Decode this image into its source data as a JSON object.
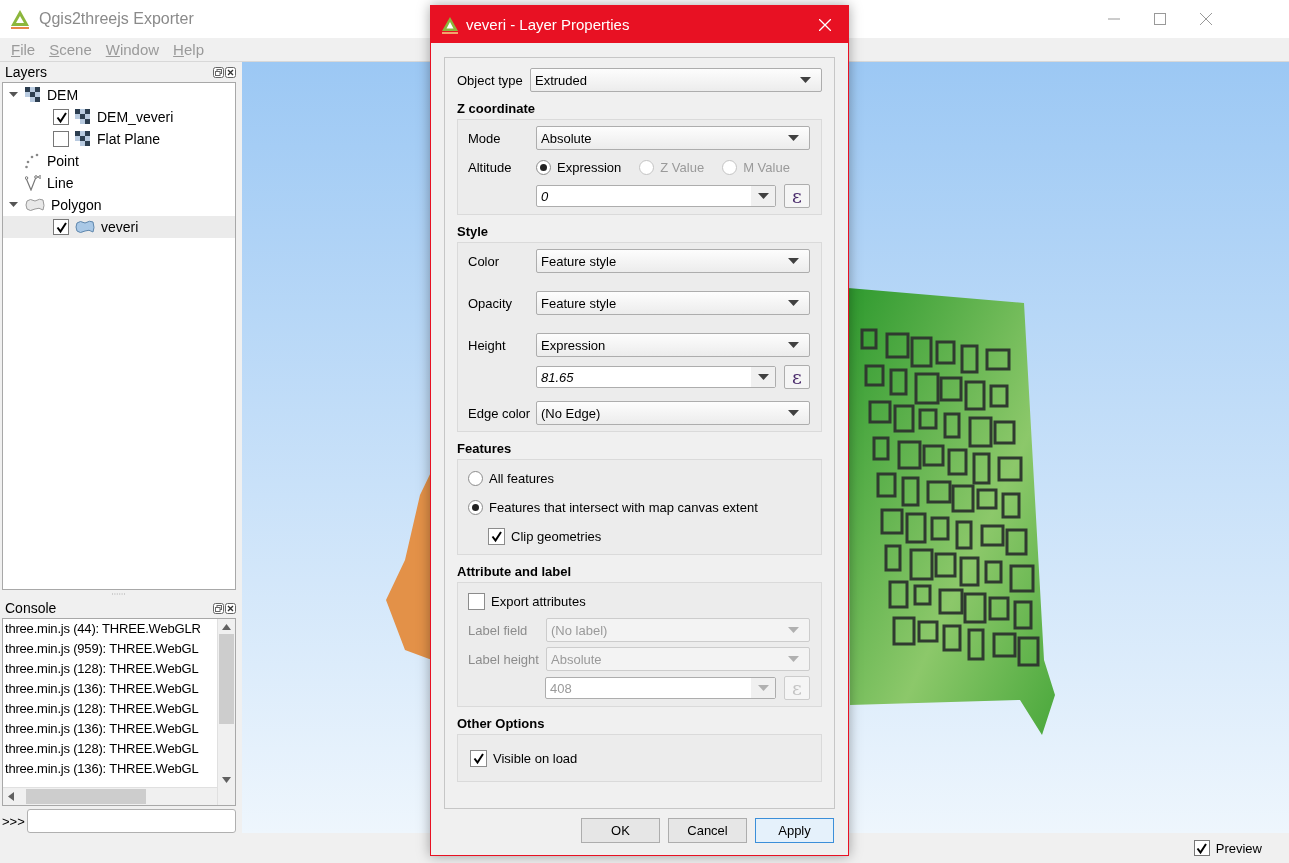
{
  "window": {
    "title": "Qgis2threejs Exporter"
  },
  "menu": [
    "File",
    "Scene",
    "Window",
    "Help"
  ],
  "layers_panel": {
    "title": "Layers",
    "tree": [
      {
        "label": "DEM",
        "kind": "raster",
        "expanded": true,
        "selected": false,
        "children": [
          {
            "label": "DEM_veveri",
            "kind": "raster",
            "checked": true,
            "selected": false
          },
          {
            "label": "Flat Plane",
            "kind": "raster",
            "checked": false,
            "selected": false
          }
        ]
      },
      {
        "label": "Point",
        "kind": "point",
        "selected": false
      },
      {
        "label": "Line",
        "kind": "line",
        "selected": false
      },
      {
        "label": "Polygon",
        "kind": "polygon",
        "expanded": true,
        "selected": false,
        "children": [
          {
            "label": "veveri",
            "kind": "polygon",
            "checked": true,
            "selected": true
          }
        ]
      }
    ]
  },
  "console": {
    "title": "Console",
    "lines": [
      "three.min.js (44): THREE.WebGLR",
      "three.min.js (959): THREE.WebGL",
      "three.min.js (128): THREE.WebGL",
      "three.min.js (136): THREE.WebGL",
      "three.min.js (128): THREE.WebGL",
      "three.min.js (136): THREE.WebGL",
      "three.min.js (128): THREE.WebGL",
      "three.min.js (136): THREE.WebGL"
    ],
    "prompt": ">>>"
  },
  "status_bar": {
    "preview": {
      "label": "Preview",
      "checked": true
    }
  },
  "dialog": {
    "title": "veveri - Layer Properties",
    "object_type": {
      "label": "Object type",
      "value": "Extruded"
    },
    "sections": [
      {
        "title": "Z coordinate",
        "rows": [
          {
            "kind": "combo",
            "label": "Mode",
            "value": "Absolute",
            "disabled": false
          },
          {
            "kind": "radios",
            "label": "Altitude",
            "options": [
              {
                "label": "Expression",
                "selected": true,
                "disabled": false
              },
              {
                "label": "Z Value",
                "selected": false,
                "disabled": true
              },
              {
                "label": "M Value",
                "selected": false,
                "disabled": true
              }
            ]
          },
          {
            "kind": "expression",
            "value": "0",
            "button": "ε",
            "disabled": false
          }
        ]
      },
      {
        "title": "Style",
        "rows": [
          {
            "kind": "combo",
            "label": "Color",
            "value": "Feature style",
            "disabled": false
          },
          {
            "kind": "combo",
            "label": "Opacity",
            "value": "Feature style",
            "disabled": false
          },
          {
            "kind": "combo",
            "label": "Height",
            "value": "Expression",
            "disabled": false
          },
          {
            "kind": "expression",
            "value": "81.65",
            "button": "ε",
            "disabled": false
          },
          {
            "kind": "combo",
            "label": "Edge color",
            "value": "(No Edge)",
            "disabled": false
          }
        ]
      },
      {
        "title": "Features",
        "rows": [
          {
            "kind": "radio",
            "label": "All features",
            "selected": false
          },
          {
            "kind": "radio",
            "label": "Features that intersect with map canvas extent",
            "selected": true
          },
          {
            "kind": "sub_checkbox",
            "label": "Clip geometries",
            "checked": true
          }
        ]
      },
      {
        "title": "Attribute and label",
        "rows": [
          {
            "kind": "checkbox",
            "label": "Export attributes",
            "checked": false
          },
          {
            "kind": "combo",
            "label": "Label field",
            "value": "(No label)",
            "disabled": true
          },
          {
            "kind": "combo",
            "label": "Label height",
            "value": "Absolute",
            "disabled": true
          },
          {
            "kind": "expression",
            "value": "408",
            "button": "ε",
            "disabled": true
          }
        ]
      },
      {
        "title": "Other Options",
        "rows": [
          {
            "kind": "checkbox",
            "label": "Visible on load",
            "checked": true
          }
        ]
      }
    ],
    "buttons": [
      {
        "label": "OK",
        "default": false
      },
      {
        "label": "Cancel",
        "default": false
      },
      {
        "label": "Apply",
        "default": true
      }
    ]
  }
}
